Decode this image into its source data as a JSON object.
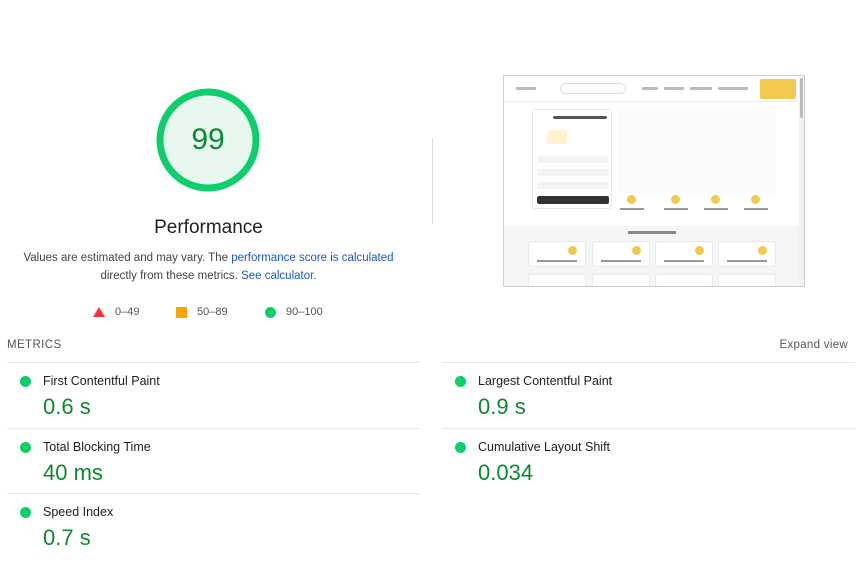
{
  "summary": {
    "score": "99",
    "score_fraction": 0.99,
    "title": "Performance",
    "desc_text_1": "Values are estimated and may vary. The ",
    "desc_link_1": "performance score is calculated",
    "desc_text_2": " directly from these metrics. ",
    "desc_link_2": "See calculator.",
    "colors": {
      "pass": "#0cce6b",
      "pass_text": "#0a8a2e",
      "average": "#ffa400",
      "fail": "#ff3333",
      "pass_bg": "#e8f8ee"
    }
  },
  "legend": [
    {
      "icon": "triangle-icon",
      "label": "0–49"
    },
    {
      "icon": "square-icon",
      "label": "50–89"
    },
    {
      "icon": "circle-icon",
      "label": "90–100"
    }
  ],
  "metrics_section": {
    "label": "METRICS",
    "expand_label": "Expand view"
  },
  "metrics": [
    {
      "label": "First Contentful Paint",
      "value": "0.6 s",
      "status": "pass"
    },
    {
      "label": "Largest Contentful Paint",
      "value": "0.9 s",
      "status": "pass"
    },
    {
      "label": "Total Blocking Time",
      "value": "40 ms",
      "status": "pass"
    },
    {
      "label": "Cumulative Layout Shift",
      "value": "0.034",
      "status": "pass"
    },
    {
      "label": "Speed Index",
      "value": "0.7 s",
      "status": "pass"
    }
  ],
  "screenshot": {
    "name": "final-page-screenshot"
  }
}
